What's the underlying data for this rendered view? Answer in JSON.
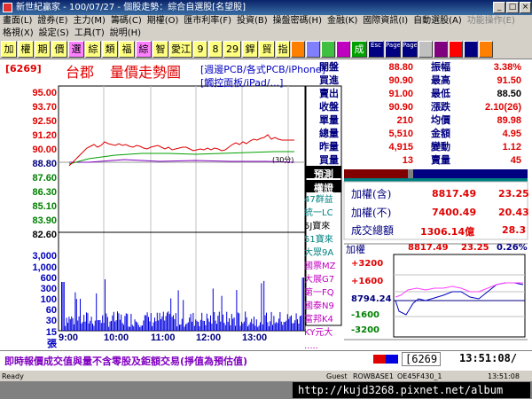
{
  "window": {
    "title": "新世紀贏家 - 100/07/27 - 個股走勢：綜合自選股[名望股]"
  },
  "menu_row1": [
    "畫面(L)",
    "證券(E)",
    "主力(M)",
    "籌碼(C)",
    "期權(O)",
    "匯市利率(F)",
    "投資(B)",
    "操盤密碼(H)",
    "金融(K)",
    "國際資訊(I)",
    "自動選股(A)",
    "功能操作(E)"
  ],
  "menu_row2": [
    "格視(X)",
    "設定(S)",
    "工具(T)",
    "說明(H)"
  ],
  "toolbar": {
    "buttons": [
      "加",
      "權",
      "期",
      "價",
      "選",
      "綜",
      "類",
      "福",
      "綜",
      "智",
      "愛江",
      "9",
      "8",
      "29",
      "銲",
      "貿",
      "指",
      "",
      "",
      "",
      "",
      "成",
      "Esc",
      "Page Up",
      "Page Down",
      "",
      "",
      "",
      "",
      ""
    ]
  },
  "quote": {
    "stock_code": "[6269]",
    "stock_name": "台郡",
    "chart_title": "量價走勢圖",
    "concept1": "[週邊PCB/各式PCB/iPhone]",
    "concept2": "[觸控面板/iPad/...]",
    "rows": [
      {
        "l1": "開盤",
        "v1": "88.80",
        "l2": "振幅",
        "v2": "3.38%"
      },
      {
        "l1": "買進",
        "v1": "90.90",
        "l2": "最高",
        "v2": "91.50"
      },
      {
        "l1": "賣出",
        "v1": "91.00",
        "l2": "最低",
        "v2": "88.50"
      },
      {
        "l1": "收盤",
        "v1": "90.90",
        "l2": "漲跌",
        "v2": "2.10(26)"
      },
      {
        "l1": "單量",
        "v1": "210",
        "l2": "均價",
        "v2": "89.98"
      },
      {
        "l1": "總量",
        "v1": "5,510",
        "l2": "金額",
        "v2": "4.95"
      },
      {
        "l1": "昨量",
        "v1": "4,915",
        "l2": "變動",
        "v2": "1.12"
      },
      {
        "l1": "買量",
        "v1": "13",
        "l2": "賣量",
        "v2": "45"
      }
    ]
  },
  "price_axis": [
    "95.00",
    "93.70",
    "92.50",
    "91.20",
    "90.00",
    "88.80",
    "87.60",
    "86.30",
    "85.10",
    "83.90",
    "82.60"
  ],
  "volume_axis": [
    "3,000",
    "1,000",
    "600",
    "300",
    "100",
    "60",
    "30",
    "15",
    "張"
  ],
  "time_axis": [
    "9:00",
    "10:00",
    "11:00",
    "12:00",
    "13:00"
  ],
  "ma_label": "(30分)",
  "side_list": {
    "predict": "預測",
    "weight": "權證",
    "items": [
      "47群益",
      "統一LC",
      "5J寶來",
      "51寶來",
      "大眾9A",
      "國票MZ",
      "大展G7",
      "第一FQ",
      "國泰N9",
      "富邦K4",
      "KY元大",
      "....."
    ]
  },
  "index": {
    "r1": {
      "label": "加權(含)",
      "value": "8817.49",
      "change": "23.25"
    },
    "r2": {
      "label": "加權(不)",
      "value": "7400.49",
      "change": "20.43"
    },
    "r3": {
      "label": "成交總額",
      "value": "1306.14億",
      "change": "28.3"
    },
    "mini_label": "加權",
    "mini_value": "8817.49",
    "mini_change": "23.25",
    "mini_pct": "0.26%",
    "mini_axis": [
      "+3200",
      "+1600",
      "8794.24",
      "-1600",
      "-3200"
    ]
  },
  "status": {
    "message": "即時報價成交值與量不含零股及鉅額交易(掙值為預估值)",
    "code": "6269",
    "time": "13:51:08/"
  },
  "winstatus": [
    "Ready",
    "Guest",
    "ROWBASE1",
    "OE45F430_1",
    "13:51:08"
  ],
  "url": "http://kujd3268.pixnet.net/album",
  "colors": {
    "price_line": "#e00000",
    "avg_line": "#00a000",
    "ref_line": "#8000c0",
    "volume": "#0000e0"
  },
  "chart_data": {
    "type": "line",
    "x": [
      "9:00",
      "9:30",
      "10:00",
      "10:30",
      "11:00",
      "11:30",
      "12:00",
      "12:30",
      "13:00",
      "13:30"
    ],
    "series": [],
    "ylim": [
      82.6,
      95.0
    ]
  }
}
